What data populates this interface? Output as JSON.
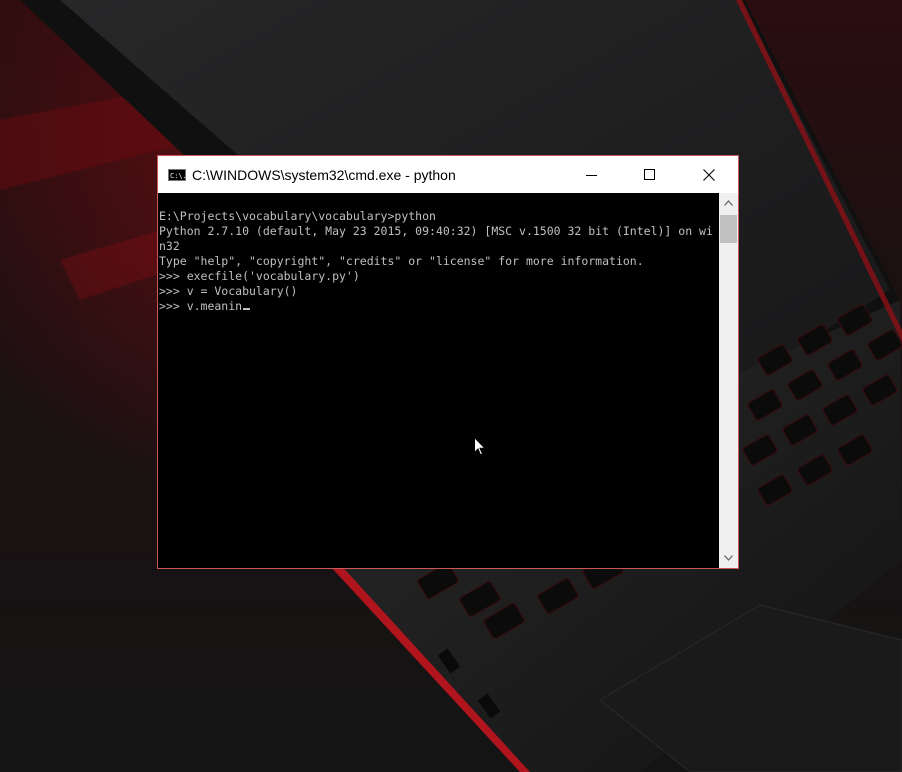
{
  "window": {
    "title": "C:\\WINDOWS\\system32\\cmd.exe - python",
    "icon": "cmd-icon",
    "icon_text": "C:\\.",
    "controls": {
      "minimize": "minimize-icon",
      "maximize": "maximize-icon",
      "close": "close-icon"
    }
  },
  "console": {
    "lines": [
      "E:\\Projects\\vocabulary\\vocabulary>python",
      "Python 2.7.10 (default, May 23 2015, 09:40:32) [MSC v.1500 32 bit (Intel)] on wi",
      "n32",
      "Type \"help\", \"copyright\", \"credits\" or \"license\" for more information.",
      ">>> execfile('vocabulary.py')",
      ">>> v = Vocabulary()"
    ],
    "current_input": ">>> v.meanin",
    "text_color": "#c0c0c0",
    "background": "#000000"
  },
  "scrollbar": {
    "up": "chevron-up-icon",
    "down": "chevron-down-icon"
  },
  "colors": {
    "window_border": "#c8585a",
    "wallpaper_accent": "#b0141c"
  }
}
